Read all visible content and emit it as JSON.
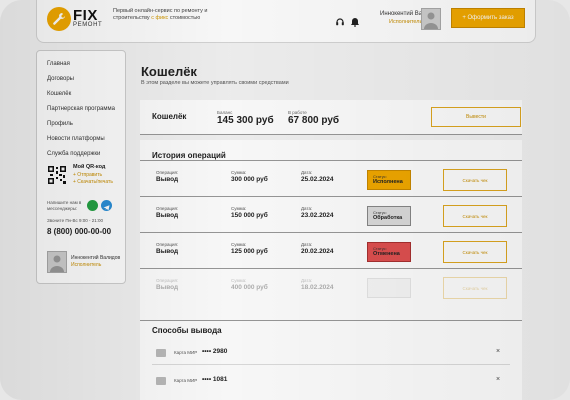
{
  "header": {
    "logo_fix": "FIX",
    "logo_remont": "РЕМОНТ",
    "tagline_main": "Первый онлайн-сервис по ремонту и строительству",
    "tagline_accent": "с фикс",
    "tagline_end": "стоимостью",
    "user_name": "Иннокентий Валидов",
    "user_role": "Исполнитель",
    "order_button": "+ Оформить заказ"
  },
  "sidebar": {
    "items": [
      {
        "label": "Главная"
      },
      {
        "label": "Договоры"
      },
      {
        "label": "Кошелёк"
      },
      {
        "label": "Партнерская программа"
      },
      {
        "label": "Профиль"
      },
      {
        "label": "Новости платформы"
      },
      {
        "label": "Служба поддержки"
      }
    ],
    "qr_title": "Мой QR-код",
    "qr_link_1": "+ Отправить",
    "qr_link_2": "+ Скачать/печать",
    "messengers_label": "Напишите нам в мессенджеры:",
    "hours": "Звоните Пн-Вс 9:00 - 21:00",
    "phone": "8 (800) 000-00-00",
    "user_name": "Иннокентий Валидов",
    "user_role": "Исполнитель"
  },
  "page": {
    "title": "Кошелёк",
    "subtitle": "В этом разделе вы можете управлять своими средствами"
  },
  "wallet": {
    "name": "Кошелёк",
    "balance_label": "Баланс",
    "balance_value": "145 300 руб",
    "in_work_label": "В работе",
    "in_work_value": "67 800 руб",
    "withdraw_button": "Вывести"
  },
  "history": {
    "title": "История операций",
    "labels": {
      "operation": "Операция:",
      "amount": "Сумма:",
      "date": "Дата:",
      "status": "Статус:"
    },
    "check_button": "Скачать чек",
    "rows": [
      {
        "operation": "Вывод",
        "amount": "300 000 руб",
        "date": "25.02.2024",
        "status": "Исполнена",
        "status_color": "#f2a900"
      },
      {
        "operation": "Вывод",
        "amount": "150 000 руб",
        "date": "23.02.2024",
        "status": "Обработка",
        "status_color": "#dcdcdc"
      },
      {
        "operation": "Вывод",
        "amount": "125 000 руб",
        "date": "20.02.2024",
        "status": "Отменена",
        "status_color": "#e05050"
      },
      {
        "operation": "Вывод",
        "amount": "400 000 руб",
        "date": "18.02.2024",
        "status": "",
        "status_color": "#f3f3f3"
      }
    ]
  },
  "methods": {
    "title": "Способы вывода",
    "cards": [
      {
        "label": "Карта МИР",
        "number": "•••• 2980"
      },
      {
        "label": "Карта МИР",
        "number": "•••• 1081"
      }
    ],
    "delete_symbol": "×"
  },
  "colors": {
    "accent": "#f2a900",
    "danger": "#e05050"
  }
}
